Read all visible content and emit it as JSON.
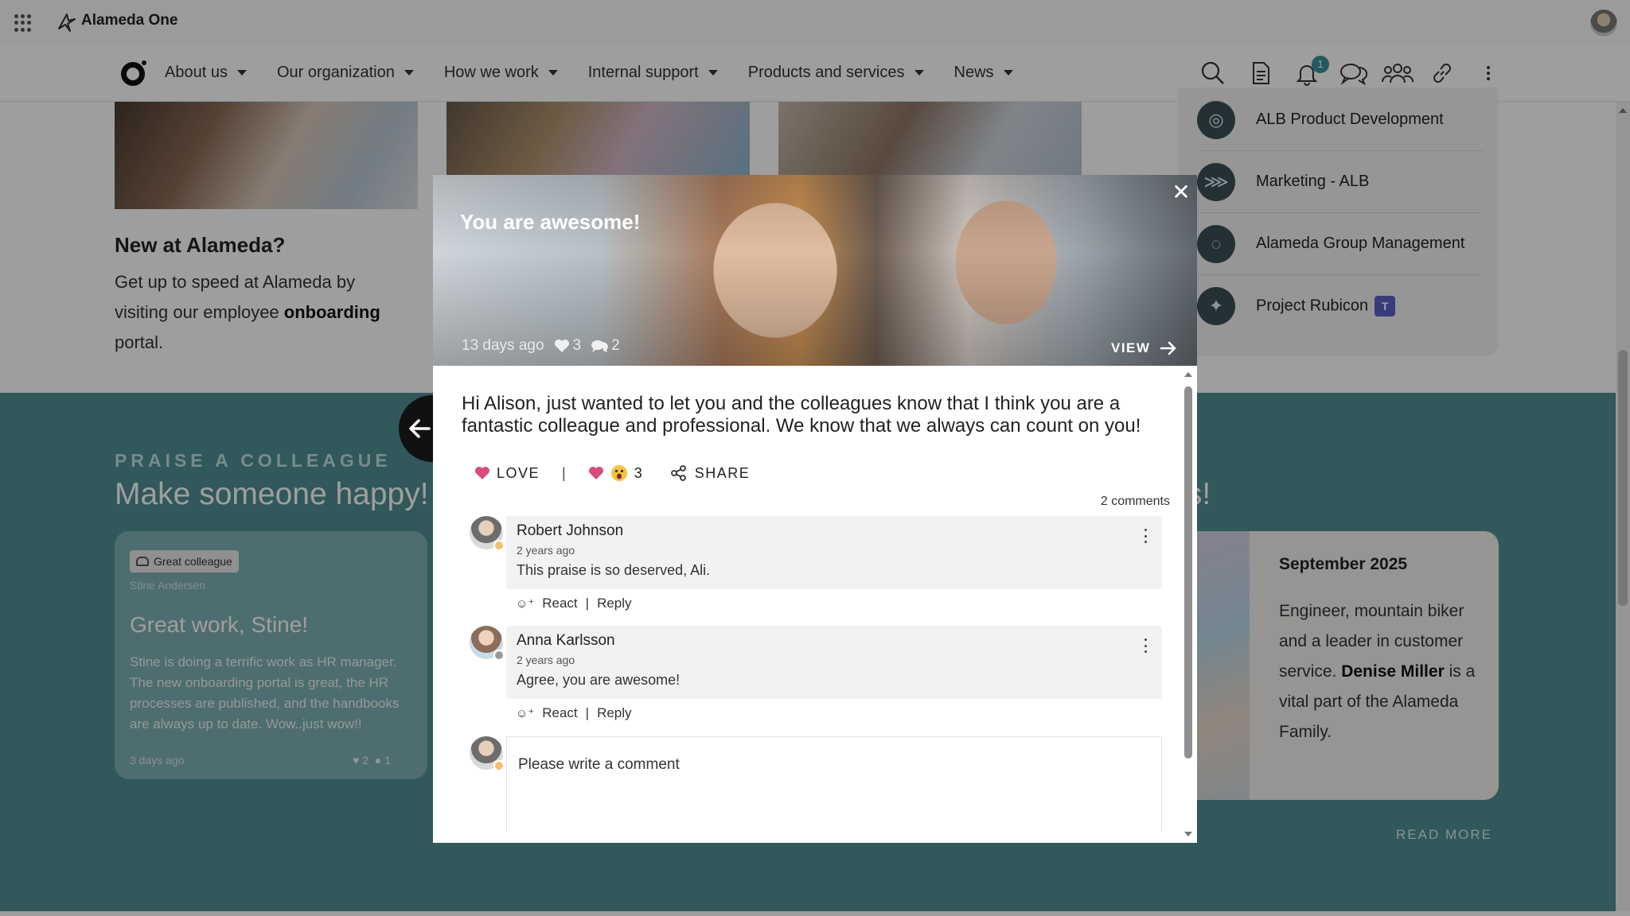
{
  "app": {
    "title": "Alameda One"
  },
  "nav": {
    "items": [
      {
        "label": "About us"
      },
      {
        "label": "Our organization"
      },
      {
        "label": "How we work"
      },
      {
        "label": "Internal support"
      },
      {
        "label": "Products and services"
      },
      {
        "label": "News"
      }
    ],
    "notification_count": "1",
    "icons": [
      "search-icon",
      "document-icon",
      "bell-icon",
      "chat-icon",
      "people-icon",
      "link-icon",
      "more-vertical-icon"
    ]
  },
  "page": {
    "new_title": "New at Alameda?",
    "new_text_1": "Get up to speed at Alameda by visiting our employee ",
    "new_text_bold": "onboarding",
    "new_text_2": " portal.",
    "groups": [
      {
        "label": "ALB Product Development",
        "icon": "target-icon"
      },
      {
        "label": "Marketing - ALB",
        "icon": "fish-icon"
      },
      {
        "label": "Alameda Group Management",
        "icon": "circle-arrows-icon"
      },
      {
        "label": "Project Rubicon",
        "icon": "leaf-icon",
        "teams_mark": "T"
      }
    ],
    "praise_kicker": "PRAISE A COLLEAGUE",
    "praise_title": "Make someone happy!",
    "right_title_fragment": "ts!",
    "praise_card": {
      "tag": "Great colleague",
      "author": "Stine Andersen",
      "heading": "Great work, Stine!",
      "body": "Stine is doing a terrific work as HR manager. The new onboarding portal is great, the HR processes are published, and the handbooks are always up to date. Wow..just wow!!",
      "time": "3 days ago",
      "likes": "2",
      "comments": "1"
    },
    "featured": {
      "date": "September 2025",
      "text_1": "Engineer, mountain biker and a leader in customer service. ",
      "text_bold": "Denise Miller",
      "text_2": " is a vital part of the Alameda Family."
    },
    "read_more": "READ MORE"
  },
  "modal": {
    "title": "You are awesome!",
    "time": "13 days ago",
    "likes": "3",
    "comments": "2",
    "view_label": "VIEW",
    "message": "Hi Alison, just wanted to let you and the colleagues know that I think you are a fantastic colleague and professional. We know that we always can count on you!",
    "love_label": "LOVE",
    "separator": "|",
    "reaction_count": "3",
    "share_label": "SHARE",
    "comments_count_label": "2 comments",
    "comments_list": [
      {
        "name": "Robert Johnson",
        "time": "2 years ago",
        "text": "This praise is so deserved, Ali.",
        "react": "React",
        "reply": "Reply"
      },
      {
        "name": "Anna Karlsson",
        "time": "2 years ago",
        "text": "Agree, you are awesome!",
        "react": "React",
        "reply": "Reply"
      }
    ],
    "comment_placeholder": "Please write a comment"
  },
  "colors": {
    "teal": "#4f8e93",
    "accent_badge": "#3a8f9e",
    "love_heart": "#d94b7d"
  }
}
